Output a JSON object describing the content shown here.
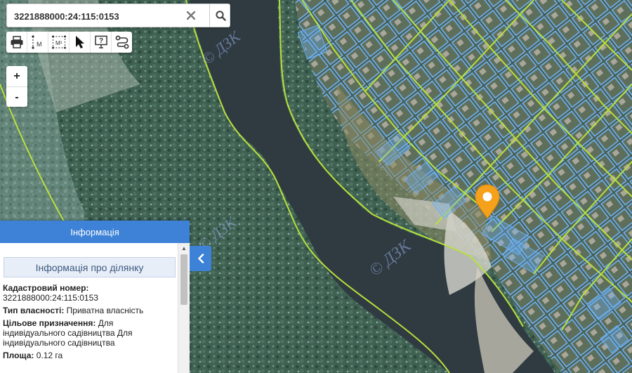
{
  "search": {
    "value": "3221888000:24:115:0153"
  },
  "icons": {
    "clear": "close-icon",
    "search": "search-icon",
    "tools": [
      "print-icon",
      "measure-distance-icon",
      "measure-area-icon",
      "pointer-icon",
      "identify-icon",
      "route-icon"
    ],
    "zoom_in": "+",
    "zoom_out": "-",
    "collapse": "chevron-left-icon",
    "marker": "map-marker-icon"
  },
  "measure": {
    "distance_label": "M",
    "area_label": "M²"
  },
  "map": {
    "watermark": "© ДЗК",
    "colors": {
      "parcel": "#5ea8f0",
      "boundary": "#b9e03c",
      "water": "#2f3b40",
      "marker": "#f5a11c",
      "panel_header": "#3d82d6"
    }
  },
  "panel": {
    "header": "Інформація",
    "section_title": "Інформація про ділянку",
    "fields": [
      {
        "label": "Кадастровий номер:",
        "value": "3221888000:24:115:0153",
        "layout": "block"
      },
      {
        "label": "Тип власності:",
        "value": "Приватна власність",
        "layout": "inline"
      },
      {
        "label": "Цільове призначення:",
        "value": "Для індивідуального садівництва Для індивідуального садівництва",
        "layout": "inline"
      },
      {
        "label": "Площа:",
        "value": "0.12 га",
        "layout": "inline"
      }
    ]
  }
}
